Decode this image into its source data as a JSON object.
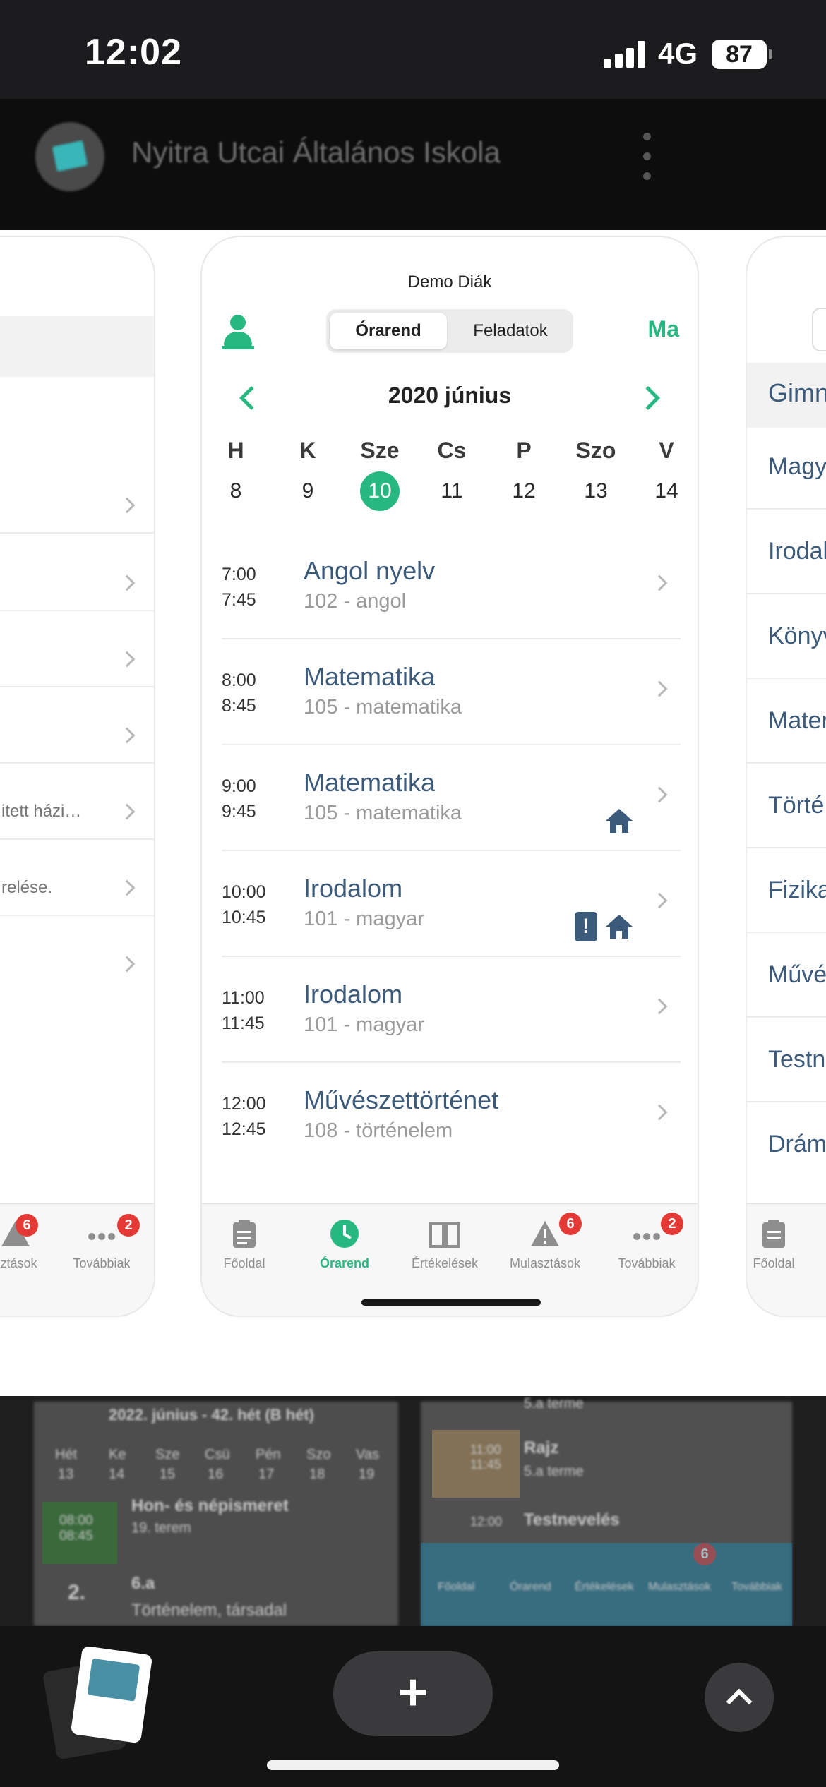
{
  "status_bar": {
    "time": "12:02",
    "network": "4G",
    "battery": "87"
  },
  "app_header": {
    "title": "Nyitra Utcai Általános Iskola"
  },
  "left_phone": {
    "snippets": [
      "itett házi…",
      "relése."
    ],
    "tabs": [
      {
        "label": "sztások",
        "badge": "6"
      },
      {
        "label": "Továbbiak",
        "badge": "2"
      }
    ]
  },
  "center_phone": {
    "student_name": "Demo Diák",
    "segments": [
      "Órarend",
      "Feladatok"
    ],
    "today_button": "Ma",
    "month": "2020 június",
    "weekdays": [
      "H",
      "K",
      "Sze",
      "Cs",
      "P",
      "Szo",
      "V"
    ],
    "days": [
      "8",
      "9",
      "10",
      "11",
      "12",
      "13",
      "14"
    ],
    "selected_day": "10",
    "lessons": [
      {
        "start": "7:00",
        "end": "7:45",
        "subject": "Angol nyelv",
        "room": "102 - angol",
        "icons": []
      },
      {
        "start": "8:00",
        "end": "8:45",
        "subject": "Matematika",
        "room": "105 - matematika",
        "icons": []
      },
      {
        "start": "9:00",
        "end": "9:45",
        "subject": "Matematika",
        "room": "105 - matematika",
        "icons": [
          "home-icon"
        ]
      },
      {
        "start": "10:00",
        "end": "10:45",
        "subject": "Irodalom",
        "room": "101 - magyar",
        "icons": [
          "note-alert-icon",
          "home-icon"
        ]
      },
      {
        "start": "11:00",
        "end": "11:45",
        "subject": "Irodalom",
        "room": "101 - magyar",
        "icons": []
      },
      {
        "start": "12:00",
        "end": "12:45",
        "subject": "Művészettörténet",
        "room": "108 - történelem",
        "icons": []
      }
    ],
    "tabs": [
      {
        "label": "Főoldal",
        "icon": "clipboard-icon"
      },
      {
        "label": "Órarend",
        "icon": "clock-icon",
        "active": true
      },
      {
        "label": "Értékelések",
        "icon": "book-icon"
      },
      {
        "label": "Mulasztások",
        "icon": "warning-icon",
        "badge": "6"
      },
      {
        "label": "Továbbiak",
        "icon": "more-icon",
        "badge": "2"
      }
    ]
  },
  "right_phone": {
    "header": "Gimn",
    "items": [
      "Magy",
      "Irodal",
      "Könyv",
      "Mater",
      "Törté",
      "Fizika",
      "Művé",
      "Testn",
      "Drám"
    ],
    "tab": "Főoldal"
  },
  "background_screens": {
    "left": {
      "week": "2022. június - 42. hét (B hét)",
      "weekdays": [
        "Hét",
        "Ke",
        "Sze",
        "Csü",
        "Pén",
        "Szo",
        "Vas"
      ],
      "days": [
        "13",
        "14",
        "15",
        "16",
        "17",
        "18",
        "19"
      ],
      "lesson1_time": "08:00 08:45",
      "lesson1_title": "Hon- és népismeret",
      "lesson1_room": "19. terem",
      "lesson2_num": "2.",
      "lesson2_class": "6.a",
      "lesson2_title": "Történelem, társadal"
    },
    "right": {
      "row0": "5.a terme",
      "row1_time": "11:00 11:45",
      "row1_title": "Rajz",
      "row1_room": "5.a terme",
      "row2_time": "12:00",
      "row2_title": "Testnevelés",
      "tabs": [
        "Főoldal",
        "Órarend",
        "Értékelések",
        "Mulasztások",
        "Továbbiak"
      ],
      "badge": "6"
    }
  },
  "bottom_bar": {
    "plus": "+"
  },
  "colors": {
    "accent": "#27b882",
    "subject": "#3c5a7a",
    "badge": "#e53935"
  }
}
